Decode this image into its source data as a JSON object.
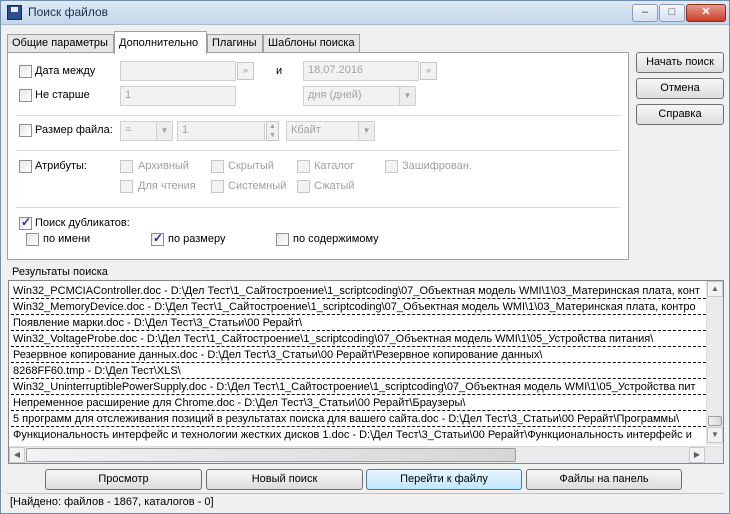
{
  "window": {
    "title": "Поиск файлов",
    "minimize": "–",
    "maximize": "□",
    "close": "✕"
  },
  "tabs": [
    {
      "label": "Общие параметры"
    },
    {
      "label": "Дополнительно"
    },
    {
      "label": "Плагины"
    },
    {
      "label": "Шаблоны поиска"
    }
  ],
  "date_between": {
    "label": "Дата между",
    "from_value": "",
    "and_label": "и",
    "to_value": "18.07.2016",
    "picker_glyph": "»"
  },
  "not_older": {
    "label": "Не старше",
    "value": "1",
    "unit": "дня (дней)"
  },
  "file_size": {
    "label": "Размер файла:",
    "operator": "=",
    "value": "1",
    "unit": "Кбайт"
  },
  "attributes": {
    "label": "Атрибуты:",
    "archive": "Архивный",
    "hidden": "Скрытый",
    "directory": "Каталог",
    "encrypted": "Зашифрован.",
    "readonly": "Для чтения",
    "system": "Системный",
    "compressed": "Сжатый"
  },
  "duplicates": {
    "label": "Поиск дубликатов:",
    "by_name": "по имени",
    "by_size": "по размеру",
    "by_content": "по содержимому"
  },
  "side_buttons": {
    "start": "Начать поиск",
    "cancel": "Отмена",
    "help": "Справка"
  },
  "results": {
    "label": "Результаты поиска",
    "rows": [
      "Win32_PCMCIAController.doc  -  D:\\Дел Тест\\1_Сайтостроение\\1_scriptcoding\\07_Объектная модель WMI\\1\\03_Материнская плата, конт",
      "Win32_MemoryDevice.doc  -  D:\\Дел Тест\\1_Сайтостроение\\1_scriptcoding\\07_Объектная модель WMI\\1\\03_Материнская плата, контро",
      "Появление марки.doc  -  D:\\Дел Тест\\3_Статьи\\00 Рерайт\\",
      "Win32_VoltageProbe.doc  -  D:\\Дел Тест\\1_Сайтостроение\\1_scriptcoding\\07_Объектная модель WMI\\1\\05_Устройства питания\\",
      "Резервное копирование данных.doc  -  D:\\Дел Тест\\3_Статьи\\00 Рерайт\\Резервное копирование данных\\",
      "8268FF60.tmp  -  D:\\Дел Тест\\XLS\\",
      "Win32_UninterruptiblePowerSupply.doc  -  D:\\Дел Тест\\1_Сайтостроение\\1_scriptcoding\\07_Объектная модель WMI\\1\\05_Устройства пит",
      "Непременное расширение для Chrome.doc  -  D:\\Дел Тест\\3_Статьи\\00 Рерайт\\Браузеры\\",
      "5 программ для отслеживания позиций в результатах поиска для вашего сайта.doc  -  D:\\Дел Тест\\3_Статьи\\00 Рерайт\\Программы\\",
      "Функциональность интерфейс и технологии жестких дисков 1.doc  -  D:\\Дел Тест\\3_Статьи\\00 Рерайт\\Функциональность интерфейс и"
    ]
  },
  "bottom_buttons": {
    "view": "Просмотр",
    "new_search": "Новый поиск",
    "goto_file": "Перейти к файлу",
    "files_to_panel": "Файлы на панель"
  },
  "status": "[Найдено: файлов - 1867, каталогов - 0]"
}
